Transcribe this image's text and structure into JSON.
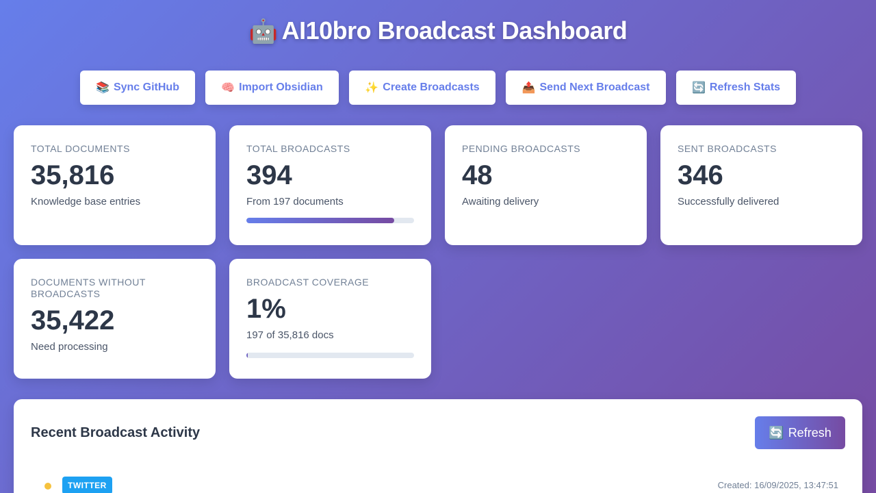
{
  "header": {
    "emoji": "🤖",
    "title": "AI10bro Broadcast Dashboard"
  },
  "actions": [
    {
      "icon": "📚",
      "icon_name": "books-icon",
      "label": "Sync GitHub"
    },
    {
      "icon": "🧠",
      "icon_name": "brain-icon",
      "label": "Import Obsidian"
    },
    {
      "icon": "✨",
      "icon_name": "sparkles-icon",
      "label": "Create Broadcasts"
    },
    {
      "icon": "📤",
      "icon_name": "outbox-icon",
      "label": "Send Next Broadcast"
    },
    {
      "icon": "🔄",
      "icon_name": "refresh-icon",
      "label": "Refresh Stats"
    }
  ],
  "stats": {
    "total_documents": {
      "label": "Total Documents",
      "value": "35,816",
      "sub": "Knowledge base entries"
    },
    "total_broadcasts": {
      "label": "Total Broadcasts",
      "value": "394",
      "sub": "From 197 documents",
      "progress_percent": 88
    },
    "pending_broadcasts": {
      "label": "Pending Broadcasts",
      "value": "48",
      "sub": "Awaiting delivery"
    },
    "sent_broadcasts": {
      "label": "Sent Broadcasts",
      "value": "346",
      "sub": "Successfully delivered"
    },
    "docs_without": {
      "label": "Documents Without Broadcasts",
      "value": "35,422",
      "sub": "Need processing"
    },
    "coverage": {
      "label": "Broadcast Coverage",
      "value": "1%",
      "sub": "197 of 35,816 docs",
      "progress_percent": 1
    }
  },
  "activity": {
    "title": "Recent Broadcast Activity",
    "refresh_icon": "🔄",
    "refresh_label": "Refresh",
    "items": [
      {
        "status_color": "#f6c23e",
        "platform": "TWITTER",
        "platform_color": "#1da1f2",
        "created": "Created: 16/09/2025, 13:47:51"
      }
    ]
  },
  "colors": {
    "accent": "#667eea",
    "accent_end": "#764ba2",
    "text": "#2d3748",
    "muted": "#718096"
  }
}
